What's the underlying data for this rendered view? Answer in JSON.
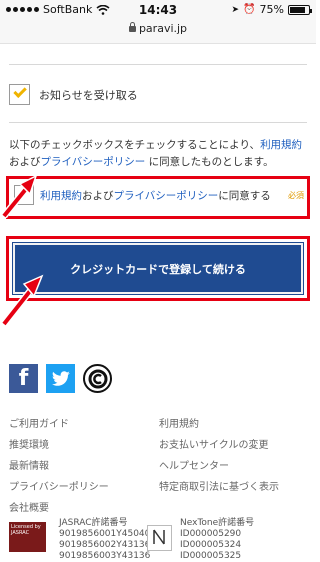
{
  "status_bar": {
    "carrier": "SoftBank",
    "time": "14:43",
    "battery": "75%",
    "url": "paravi.jp"
  },
  "notice": {
    "label": "お知らせを受け取る",
    "checked": true
  },
  "description": {
    "text_before": "以下のチェックボックスをチェックすることにより、",
    "terms_link": "利用規約",
    "and": "および",
    "privacy_link": "プライバシーポリシー",
    "text_after": " に同意したものとします。"
  },
  "agree": {
    "terms_link": "利用規約",
    "and": "および",
    "privacy_link": "プライバシーポリシー",
    "suffix": "に同意する",
    "required": "必須",
    "checked": false
  },
  "cta": {
    "label": "クレジットカードで登録して続ける"
  },
  "footer": {
    "left_links": [
      "ご利用ガイド",
      "推奨環境",
      "最新情報",
      "プライバシーポリシー",
      "会社概要"
    ],
    "right_links": [
      "利用規約",
      "お支払いサイクルの変更",
      "ヘルプセンター",
      "特定商取引法に基づく表示"
    ],
    "jasrac": {
      "badge": "Licensed by JASRAC",
      "title": "JASRAC許諾番号",
      "numbers": [
        "9019856001Y45040",
        "9019856002Y43136",
        "9019856003Y43136"
      ]
    },
    "nextone": {
      "title": "NexTone許諾番号",
      "numbers": [
        "ID000005290",
        "ID000005324",
        "ID000005325"
      ]
    }
  },
  "colors": {
    "highlight": "#e60012",
    "link": "#1f5fbf",
    "cta": "#1f4b91",
    "check": "#f0b400",
    "required": "#e09a00"
  }
}
